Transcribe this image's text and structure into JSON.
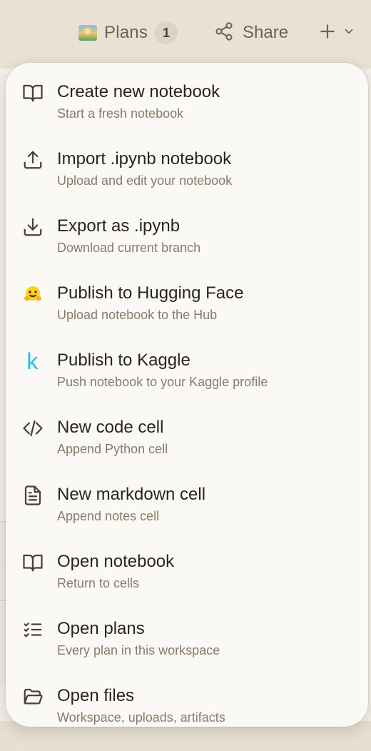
{
  "topbar": {
    "plans_label": "Plans",
    "plans_count": "1",
    "share_label": "Share"
  },
  "colors": {
    "background_top": "#e9e1d6",
    "menu_background": "#fbf9f6",
    "title_text": "#2b241d",
    "subtitle_text": "#8a7a68",
    "kaggle_blue": "#20beff",
    "hugging_face_yellow": "#ffd21e"
  },
  "menu": {
    "items": [
      {
        "icon": "book-open-icon",
        "title": "Create new notebook",
        "subtitle": "Start a fresh notebook"
      },
      {
        "icon": "upload-icon",
        "title": "Import .ipynb notebook",
        "subtitle": "Upload and edit your notebook"
      },
      {
        "icon": "download-icon",
        "title": "Export as .ipynb",
        "subtitle": "Download current branch"
      },
      {
        "icon": "hugging-face-icon",
        "title": "Publish to Hugging Face",
        "subtitle": "Upload notebook to the Hub"
      },
      {
        "icon": "kaggle-icon",
        "title": "Publish to Kaggle",
        "subtitle": "Push notebook to your Kaggle profile"
      },
      {
        "icon": "code-icon",
        "title": "New code cell",
        "subtitle": "Append Python cell"
      },
      {
        "icon": "document-icon",
        "title": "New markdown cell",
        "subtitle": "Append notes cell"
      },
      {
        "icon": "book-open-icon",
        "title": "Open notebook",
        "subtitle": "Return to cells"
      },
      {
        "icon": "checklist-icon",
        "title": "Open plans",
        "subtitle": "Every plan in this workspace"
      },
      {
        "icon": "folder-open-icon",
        "title": "Open files",
        "subtitle": "Workspace, uploads, artifacts"
      }
    ]
  }
}
